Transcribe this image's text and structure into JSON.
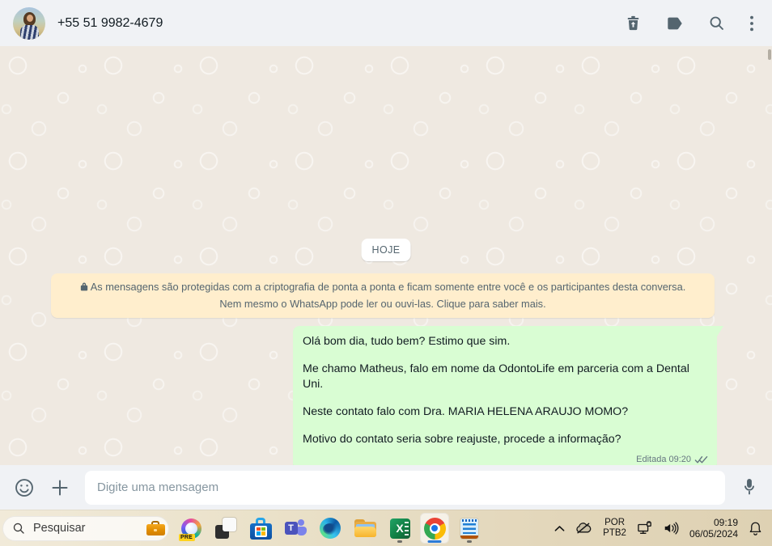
{
  "header": {
    "phone": "+55 51 9982-4679",
    "icon_names": [
      "delete-trash-icon",
      "label-tag-icon",
      "search-icon",
      "kebab-menu-icon"
    ]
  },
  "chat": {
    "date_badge": "HOJE",
    "encryption_notice": "As mensagens são protegidas com a criptografia de ponta a ponta e ficam somente entre você e os participantes desta conversa. Nem mesmo o WhatsApp pode ler ou ouvi-las. Clique para saber mais.",
    "message": {
      "paragraphs": [
        "Olá bom dia, tudo bem? Estimo que sim.",
        "Me chamo Matheus, falo em nome da OdontoLife em parceria com a Dental Uni.",
        "Neste contato falo com Dra. MARIA HELENA ARAUJO MOMO?",
        "Motivo do contato seria sobre reajuste, procede a informação?"
      ],
      "meta": {
        "edited_label": "Editada",
        "time": "09:20",
        "status": "delivered-double-check"
      }
    }
  },
  "composer": {
    "placeholder": "Digite uma mensagem",
    "icon_names": [
      "emoji-smiley-icon",
      "attach-plus-icon",
      "mic-icon"
    ]
  },
  "taskbar": {
    "search_label": "Pesquisar",
    "copilot_badge": "PRE",
    "apps": [
      "copilot",
      "task-view",
      "microsoft-store",
      "teams",
      "edge",
      "file-explorer",
      "excel",
      "chrome",
      "notepad"
    ],
    "active_app": "chrome",
    "running_apps": [
      "excel",
      "notepad",
      "chrome"
    ],
    "excel_letter": "X",
    "teams_letter": "T"
  },
  "tray": {
    "language": "POR",
    "layout": "PTB2",
    "time": "09:19",
    "date": "06/05/2024",
    "icon_names": [
      "chevron-up-icon",
      "onedrive-off-icon",
      "ethernet-icon",
      "volume-icon",
      "bell-icon"
    ]
  },
  "colors": {
    "header_bg": "#f0f2f5",
    "chat_bg": "#efe9e1",
    "bubble": "#d9fdd3",
    "banner": "#ffeecd",
    "icon_gray": "#54656f",
    "accent_blue": "#2d7cd6"
  }
}
